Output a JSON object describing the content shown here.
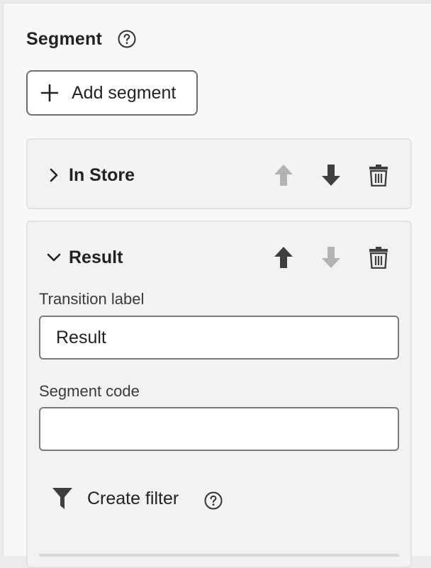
{
  "panel": {
    "title": "Segment",
    "add_button_label": "Add segment"
  },
  "segments": [
    {
      "title": "In Store",
      "expanded": false,
      "move_up_enabled": false,
      "move_down_enabled": true
    },
    {
      "title": "Result",
      "expanded": true,
      "move_up_enabled": true,
      "move_down_enabled": false,
      "transition_label_caption": "Transition label",
      "transition_label_value": "Result",
      "segment_code_caption": "Segment code",
      "segment_code_value": "",
      "create_filter_label": "Create filter"
    }
  ],
  "icons": {
    "help": "help-circle-icon",
    "add": "plus-icon",
    "collapsed": "chevron-right-icon",
    "expanded": "chevron-down-icon",
    "up": "arrow-up-icon",
    "down": "arrow-down-icon",
    "delete": "trash-icon",
    "filter": "funnel-icon"
  },
  "colors": {
    "icon_enabled": "#4b4b4b",
    "icon_disabled": "#b3b3b3"
  }
}
